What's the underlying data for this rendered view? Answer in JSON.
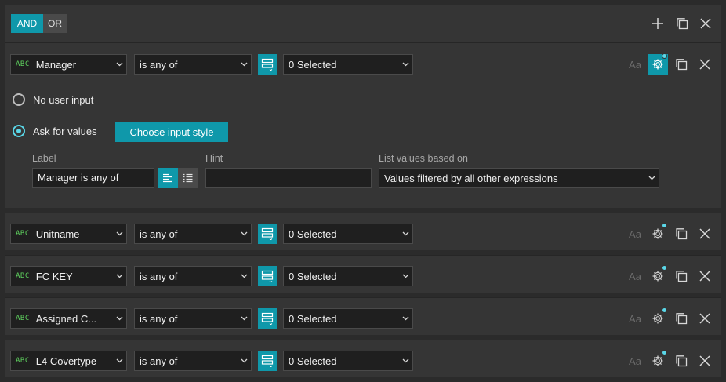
{
  "logic": {
    "and_label": "AND",
    "or_label": "OR",
    "active": "AND"
  },
  "colors": {
    "accent": "#0f98aa",
    "abc_tag": "#5fd35f",
    "panel": "#353535",
    "field": "#1f1f1f"
  },
  "icons": [
    "plus-icon",
    "duplicate-icon",
    "close-icon",
    "chevron-down-icon",
    "list-icon",
    "gear-icon",
    "text-size-icon",
    "align-left-icon",
    "bullet-list-icon"
  ],
  "expressions": [
    {
      "type_tag": "ABC",
      "field": "Manager",
      "operator": "is any of",
      "value": "0 Selected",
      "aa": "Aa",
      "expanded": true
    },
    {
      "type_tag": "ABC",
      "field": "Unitname",
      "operator": "is any of",
      "value": "0 Selected",
      "aa": "Aa"
    },
    {
      "type_tag": "ABC",
      "field": "FC KEY",
      "operator": "is any of",
      "value": "0 Selected",
      "aa": "Aa"
    },
    {
      "type_tag": "ABC",
      "field": "Assigned C...",
      "operator": "is any of",
      "value": "0 Selected",
      "aa": "Aa"
    },
    {
      "type_tag": "ABC",
      "field": "L4 Covertype",
      "operator": "is any of",
      "value": "0 Selected",
      "aa": "Aa"
    }
  ],
  "settings": {
    "no_user_input": "No user input",
    "ask_for_values": "Ask for values",
    "selected_option": "Ask for values",
    "choose_input_style": "Choose input style",
    "label_title": "Label",
    "label_value": "Manager is any of",
    "hint_title": "Hint",
    "hint_value": "",
    "list_values_title": "List values based on",
    "list_values_value": "Values filtered by all other expressions"
  }
}
